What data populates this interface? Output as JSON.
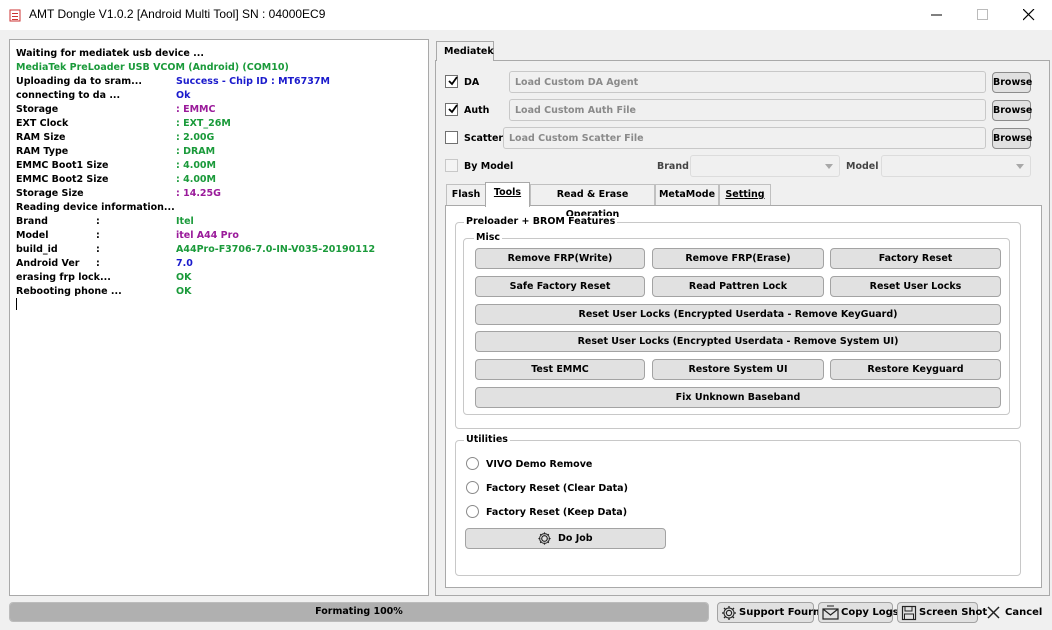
{
  "window": {
    "title": "AMT Dongle V1.0.2 [Android Multi Tool] SN : 04000EC9"
  },
  "log": {
    "lines": [
      {
        "text": "Waiting for mediatek usb device ...",
        "color": "#000000"
      },
      {
        "text": "MediaTek PreLoader USB VCOM (Android) (COM10)",
        "color": "#1a9a3a"
      },
      {
        "text": "Uploading da to sram...",
        "color": "#000000",
        "value": "Success - Chip ID  : MT6737M",
        "value_color": "#1a1acc"
      },
      {
        "text": "connecting to da ...",
        "color": "#000000",
        "value": "Ok",
        "value_color": "#1a1acc"
      },
      {
        "text": "Storage",
        "color": "#000000",
        "value": ": EMMC",
        "value_color": "#9a1a9a"
      },
      {
        "text": "EXT Clock",
        "color": "#000000",
        "value": ": EXT_26M",
        "value_color": "#1a9a3a"
      },
      {
        "text": "RAM Size",
        "color": "#000000",
        "value": ": 2.00G",
        "value_color": "#1a9a3a"
      },
      {
        "text": "RAM Type",
        "color": "#000000",
        "value": ": DRAM",
        "value_color": "#1a9a3a"
      },
      {
        "text": "EMMC Boot1 Size",
        "color": "#000000",
        "value": ": 4.00M",
        "value_color": "#1a9a3a"
      },
      {
        "text": "EMMC Boot2 Size",
        "color": "#000000",
        "value": ": 4.00M",
        "value_color": "#1a9a3a"
      },
      {
        "text": "Storage Size",
        "color": "#000000",
        "value": ": 14.25G",
        "value_color": "#9a1a9a"
      },
      {
        "text": "Reading device information...",
        "color": "#000000"
      },
      {
        "text": "Brand",
        "color": "#000000",
        "sep": ":",
        "value": "Itel",
        "value_color": "#1a9a3a"
      },
      {
        "text": "Model",
        "color": "#000000",
        "sep": ":",
        "value": "itel A44 Pro",
        "value_color": "#9a1a9a"
      },
      {
        "text": "build_id",
        "color": "#000000",
        "sep": ":",
        "value": "A44Pro-F3706-7.0-IN-V035-20190112",
        "value_color": "#1a9a3a"
      },
      {
        "text": "Android Ver",
        "color": "#000000",
        "sep": ":",
        "value": "7.0",
        "value_color": "#1a1acc"
      },
      {
        "text": "erasing frp lock...",
        "color": "#000000",
        "value": "OK",
        "value_color": "#1a9a3a"
      },
      {
        "text": "Rebooting phone ...",
        "color": "#000000",
        "value": "OK",
        "value_color": "#1a9a3a"
      }
    ]
  },
  "mediatek_tab": {
    "label": "Mediatek"
  },
  "options": {
    "da": {
      "label": "DA",
      "checked": true,
      "placeholder": "Load Custom DA Agent",
      "browse": "Browse"
    },
    "auth": {
      "label": "Auth",
      "checked": true,
      "placeholder": "Load Custom Auth File",
      "browse": "Browse"
    },
    "scatter": {
      "label": "Scatter",
      "checked": false,
      "placeholder": "Load Custom Scatter File",
      "browse": "Browse"
    },
    "by_model": {
      "label": "By Model",
      "checked": false
    },
    "brand_label": "Brand",
    "model_label": "Model"
  },
  "inner_tabs": [
    {
      "label": "Flash"
    },
    {
      "label": "Tools",
      "active": true
    },
    {
      "label": "Read & Erase Operation"
    },
    {
      "label": "MetaMode"
    },
    {
      "label": "Setting"
    }
  ],
  "features": {
    "group_title": "Preloader + BROM Features",
    "misc_title": "Misc",
    "buttons": {
      "remove_frp_write": "Remove FRP(Write)",
      "remove_frp_erase": "Remove FRP(Erase)",
      "factory_reset": "Factory Reset",
      "safe_factory_reset": "Safe Factory Reset",
      "read_pattern_lock": "Read Pattren Lock",
      "reset_user_locks": "Reset User Locks",
      "reset_keyguard": "Reset User Locks (Encrypted Userdata - Remove KeyGuard)",
      "reset_system_ui": "Reset User Locks (Encrypted Userdata - Remove System UI)",
      "test_emmc": "Test EMMC",
      "restore_system_ui": "Restore System UI",
      "restore_keyguard": "Restore Keyguard",
      "fix_baseband": "Fix Unknown Baseband"
    }
  },
  "utilities": {
    "title": "Utilities",
    "options": [
      {
        "label": "VIVO Demo Remove"
      },
      {
        "label": "Factory Reset (Clear Data)"
      },
      {
        "label": "Factory Reset (Keep Data)"
      }
    ],
    "do_job": "Do Job"
  },
  "bottom": {
    "progress_text": "Formating 100%",
    "progress_value": 100,
    "support": "Support Fourm",
    "copy_logs": "Copy Logs",
    "screen_shot": "Screen Shot",
    "cancel": "Cancel"
  }
}
